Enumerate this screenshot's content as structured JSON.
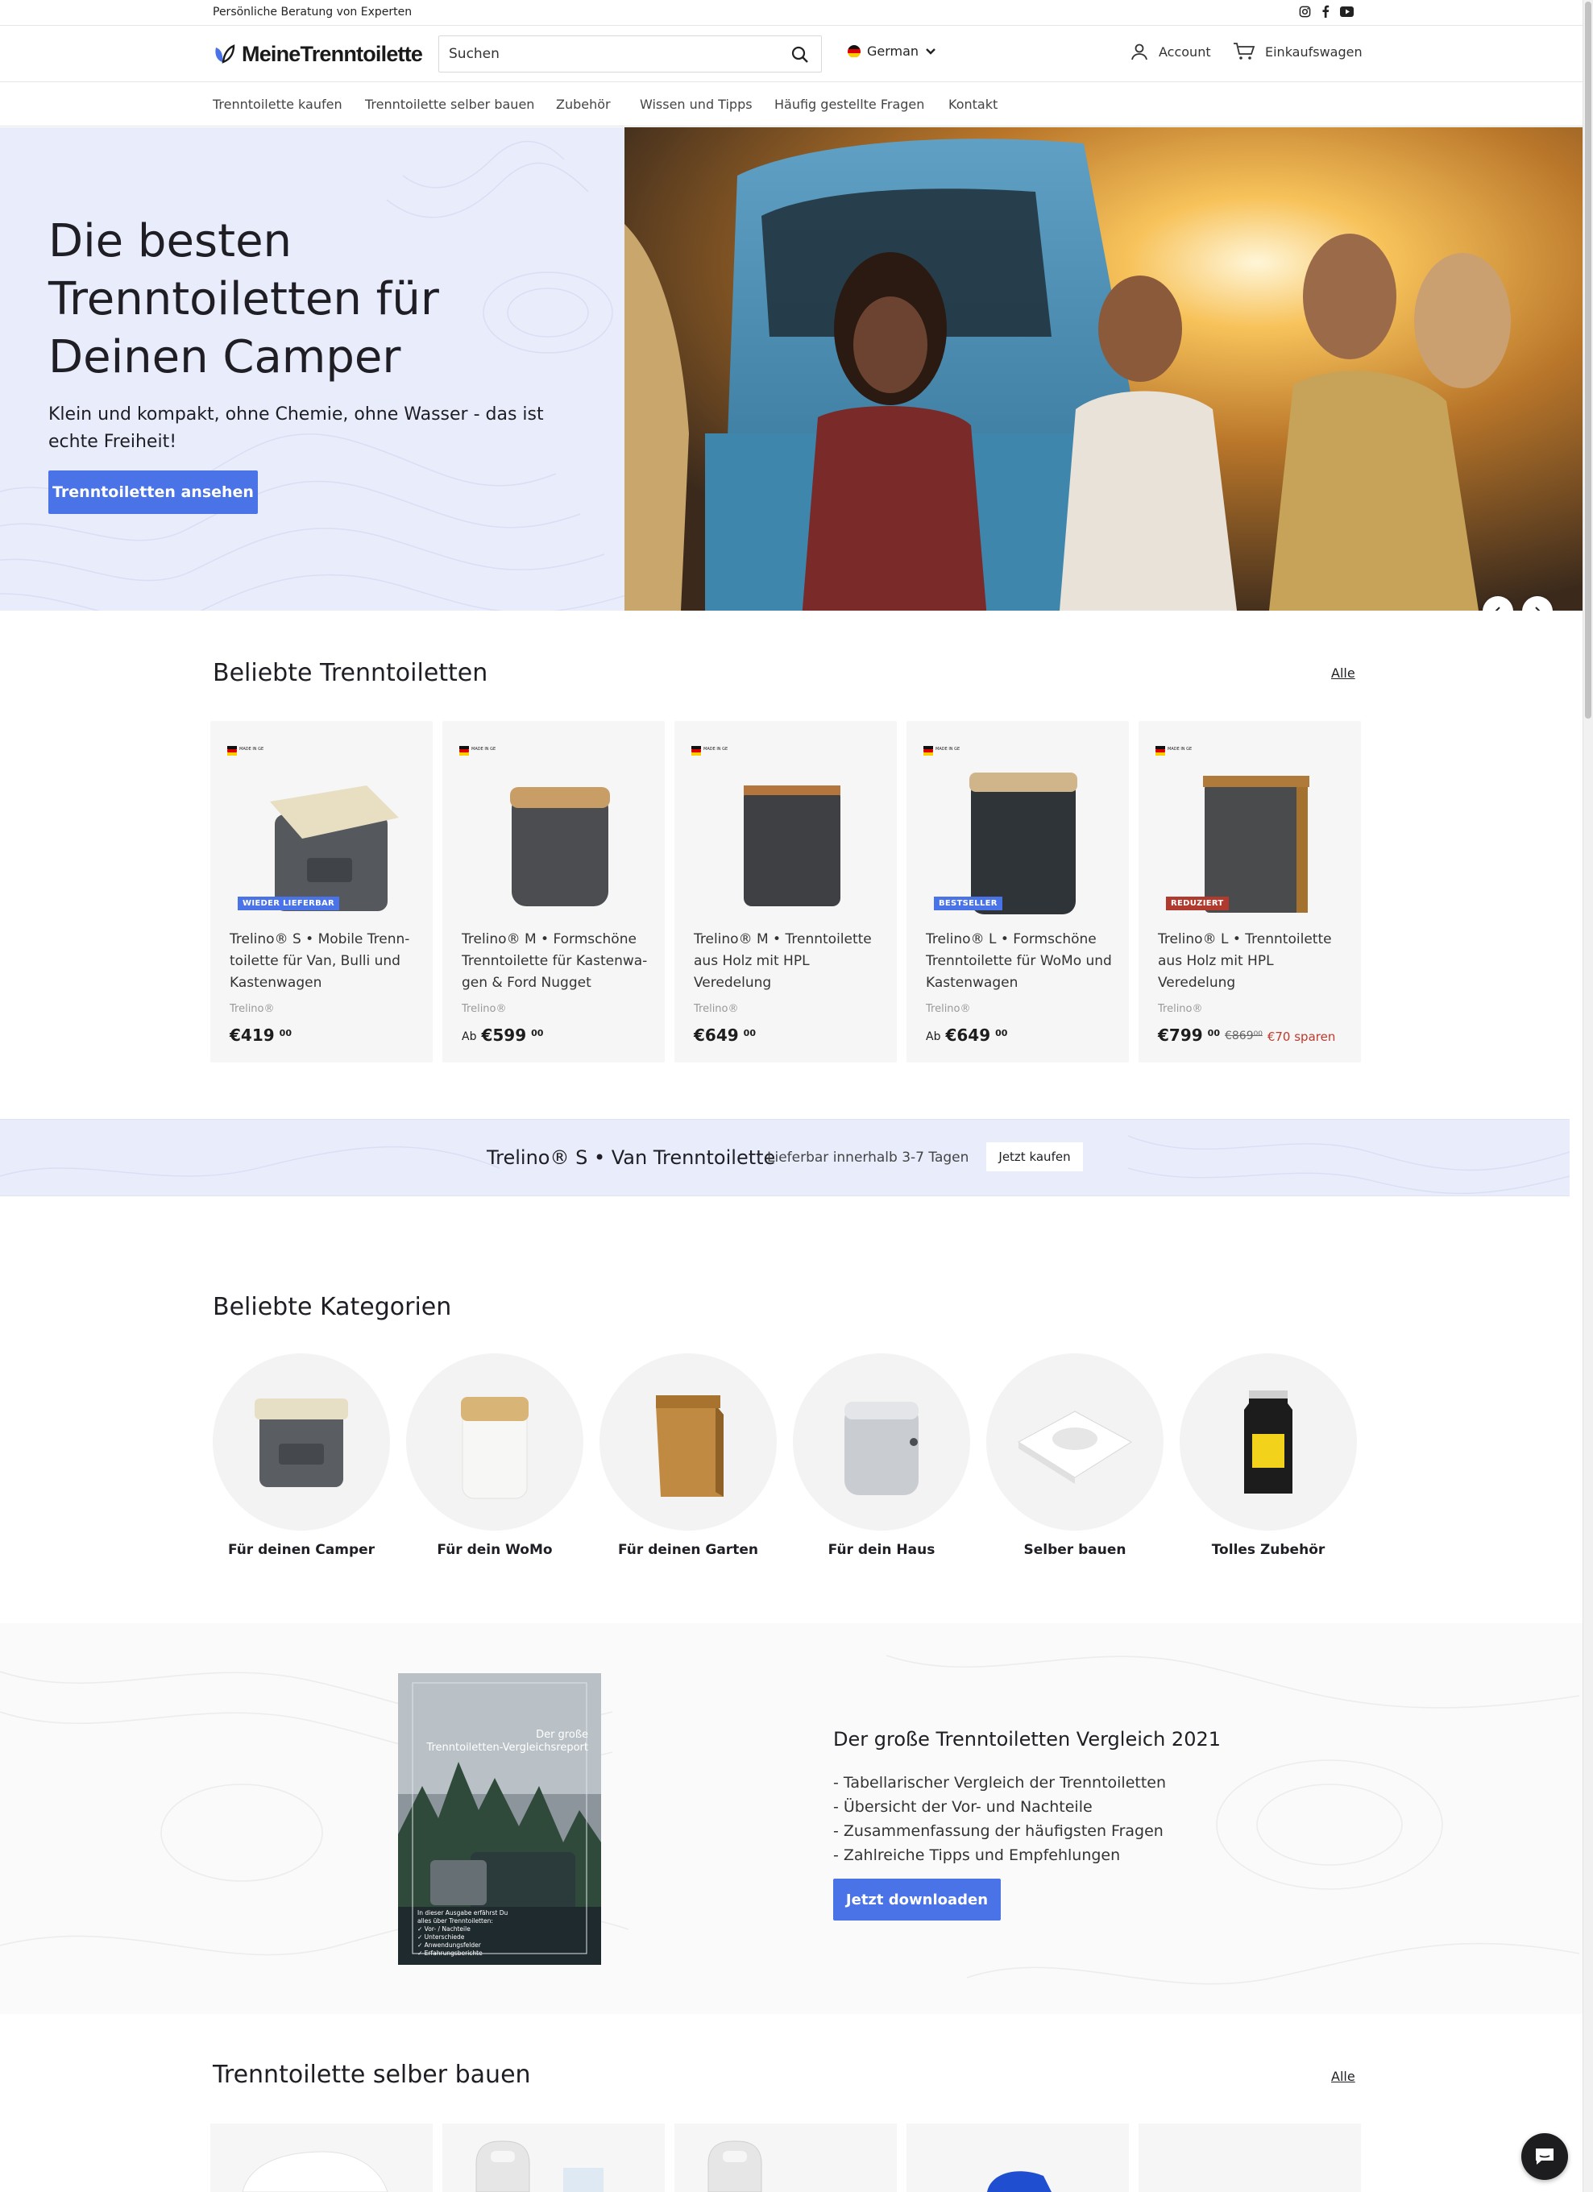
{
  "announcement": {
    "text": "Persönliche Beratung von Experten",
    "social": [
      "instagram-icon",
      "facebook-icon",
      "youtube-icon"
    ]
  },
  "header": {
    "logo_text": "MeineTrenntoilette",
    "search_placeholder": "Suchen",
    "language": "German",
    "account_label": "Account",
    "cart_label": "Einkaufswagen"
  },
  "nav": [
    "Trenntoilette kaufen",
    "Trenntoilette selber bauen",
    "Zubehör",
    "Wissen und Tipps",
    "Häufig gestellte Fragen",
    "Kontakt"
  ],
  "hero": {
    "title": "Die besten Trenntoiletten für Deinen Camper",
    "subtitle": "Klein und kompakt, ohne Chemie, ohne Wasser - das ist echte Freiheit!",
    "button": "Trenntoiletten ansehen"
  },
  "popular": {
    "title": "Beliebte Trenntoiletten",
    "all_link": "Alle",
    "products": [
      {
        "title": "Trelino® S • Mobile Trenn-toilette für Van, Bulli und Kastenwagen",
        "brand": "Trelino®",
        "prefix": "",
        "price": "€419",
        "cents": "00",
        "old_price": "",
        "save": "",
        "badge": "WIEDER LIEFERBAR",
        "badge_color": "#4a73e8",
        "made_in": "MADE IN GERMANY"
      },
      {
        "title": "Trelino® M • Formschöne Trenntoilette für Kastenwa-gen & Ford Nugget",
        "brand": "Trelino®",
        "prefix": "Ab",
        "price": "€599",
        "cents": "00",
        "old_price": "",
        "save": "",
        "badge": "",
        "badge_color": "",
        "made_in": "MADE IN GERMANY"
      },
      {
        "title": "Trelino® M • Trenntoilette aus Holz mit HPL Veredelung",
        "brand": "Trelino®",
        "prefix": "",
        "price": "€649",
        "cents": "00",
        "old_price": "",
        "save": "",
        "badge": "",
        "badge_color": "",
        "made_in": "MADE IN GERMANY"
      },
      {
        "title": "Trelino® L • Formschöne Trenntoilette für WoMo und Kastenwagen",
        "brand": "Trelino®",
        "prefix": "Ab",
        "price": "€649",
        "cents": "00",
        "old_price": "",
        "save": "",
        "badge": "BESTSELLER",
        "badge_color": "#4a73e8",
        "made_in": "MADE IN GERMANY"
      },
      {
        "title": "Trelino® L • Trenntoilette aus Holz mit HPL Veredelung",
        "brand": "Trelino®",
        "prefix": "",
        "price": "€799",
        "cents": "00",
        "old_price": "€869⁰⁰",
        "save": "€70 sparen",
        "badge": "REDUZIERT",
        "badge_color": "#b03a2e",
        "made_in": "MADE IN GERMANY"
      }
    ]
  },
  "promo": {
    "title": "Trelino® S • Van Trenntoilette",
    "desc": "Lieferbar innerhalb 3-7 Tagen",
    "button": "Jetzt kaufen"
  },
  "categories": {
    "title": "Beliebte Kategorien",
    "items": [
      "Für deinen Camper",
      "Für dein WoMo",
      "Für deinen Garten",
      "Für dein Haus",
      "Selber bauen",
      "Tolles Zubehör"
    ]
  },
  "report": {
    "cover_title": "Der große Trenntoiletten-Vergleichsreport",
    "cover_lines": [
      "In dieser Ausgabe erfährst Du",
      "alles über Trenntoiletten:",
      "✓ Vor- / Nachteile",
      "✓ Unterschiede",
      "✓ Anwendungsfelder",
      "✓ Erfahrungsberichte"
    ],
    "title": "Der große Trenntoiletten Vergleich 2021",
    "bullets": [
      "- Tabellarischer Vergleich der Trenntoiletten",
      "- Übersicht der Vor- und Nachteile",
      "- Zusammenfassung der häufigsten Fragen",
      "- Zahlreiche Tipps und Empfehlungen"
    ],
    "button": "Jetzt downloaden"
  },
  "diy": {
    "title": "Trenntoilette selber bauen",
    "all_link": "Alle"
  },
  "colors": {
    "accent": "#4a73e8",
    "hero_bg": "#e8ecfb",
    "sale": "#c0392b"
  }
}
